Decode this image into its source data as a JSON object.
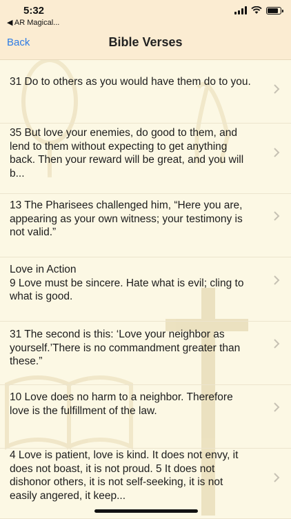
{
  "status_bar": {
    "time": "5:32",
    "back_app": "◀ AR Magical..."
  },
  "nav": {
    "back_label": "Back",
    "title": "Bible Verses"
  },
  "verses": [
    "31 Do to others as you would have them do to you.",
    "35 But love your enemies, do good to them, and lend to them without expecting to get anything back. Then your reward will be great, and you will b...",
    "13 The Pharisees challenged him, “Here you are, appearing as your own witness; your testimony is not valid.”",
    "Love in Action\n                 9 Love must be sincere. Hate what is evil; cling to what is good.",
    "31 The second is this: ‘Love your neighbor as yourself.’There is no commandment greater than these.”",
    "10 Love does no harm to a neighbor. Therefore love is the fulfillment of the law.",
    "4 Love is patient, love is kind. It does not envy, it does not boast, it is not proud. 5 It does not dishonor others, it is not self-seeking, it is not easily angered, it keep..."
  ],
  "colors": {
    "nav_background": "#fbecd2",
    "page_background": "#fcf8e4",
    "link": "#2c7be5"
  }
}
